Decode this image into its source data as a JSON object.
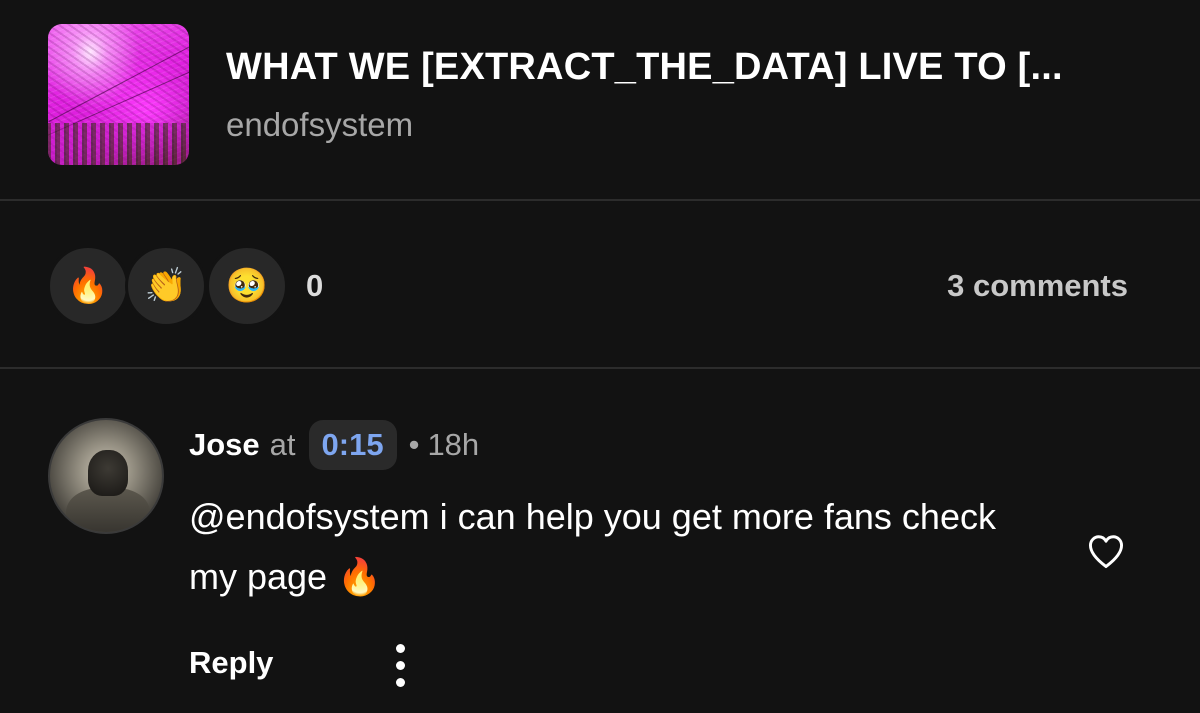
{
  "track": {
    "title": "WHAT WE [EXTRACT_THE_DATA] LIVE TO [...",
    "artist": "endofsystem"
  },
  "reactions": {
    "items": [
      {
        "emoji": "🔥",
        "icon": "fire-emoji-icon"
      },
      {
        "emoji": "👏",
        "icon": "clapping-hands-emoji-icon"
      },
      {
        "emoji": "🥹",
        "icon": "holding-back-tears-emoji-icon"
      }
    ],
    "count": "0",
    "comments_label": "3 comments"
  },
  "comment": {
    "username": "Jose",
    "at_word": "at",
    "timestamp": "0:15",
    "separator": "•",
    "age": "18h",
    "text": "@endofsystem i can help you get more fans check my page",
    "text_emoji": "🔥",
    "reply_label": "Reply"
  },
  "colors": {
    "background": "#121212",
    "timestamp_link": "#7ea6f0",
    "secondary_text": "#a7a7a7"
  }
}
